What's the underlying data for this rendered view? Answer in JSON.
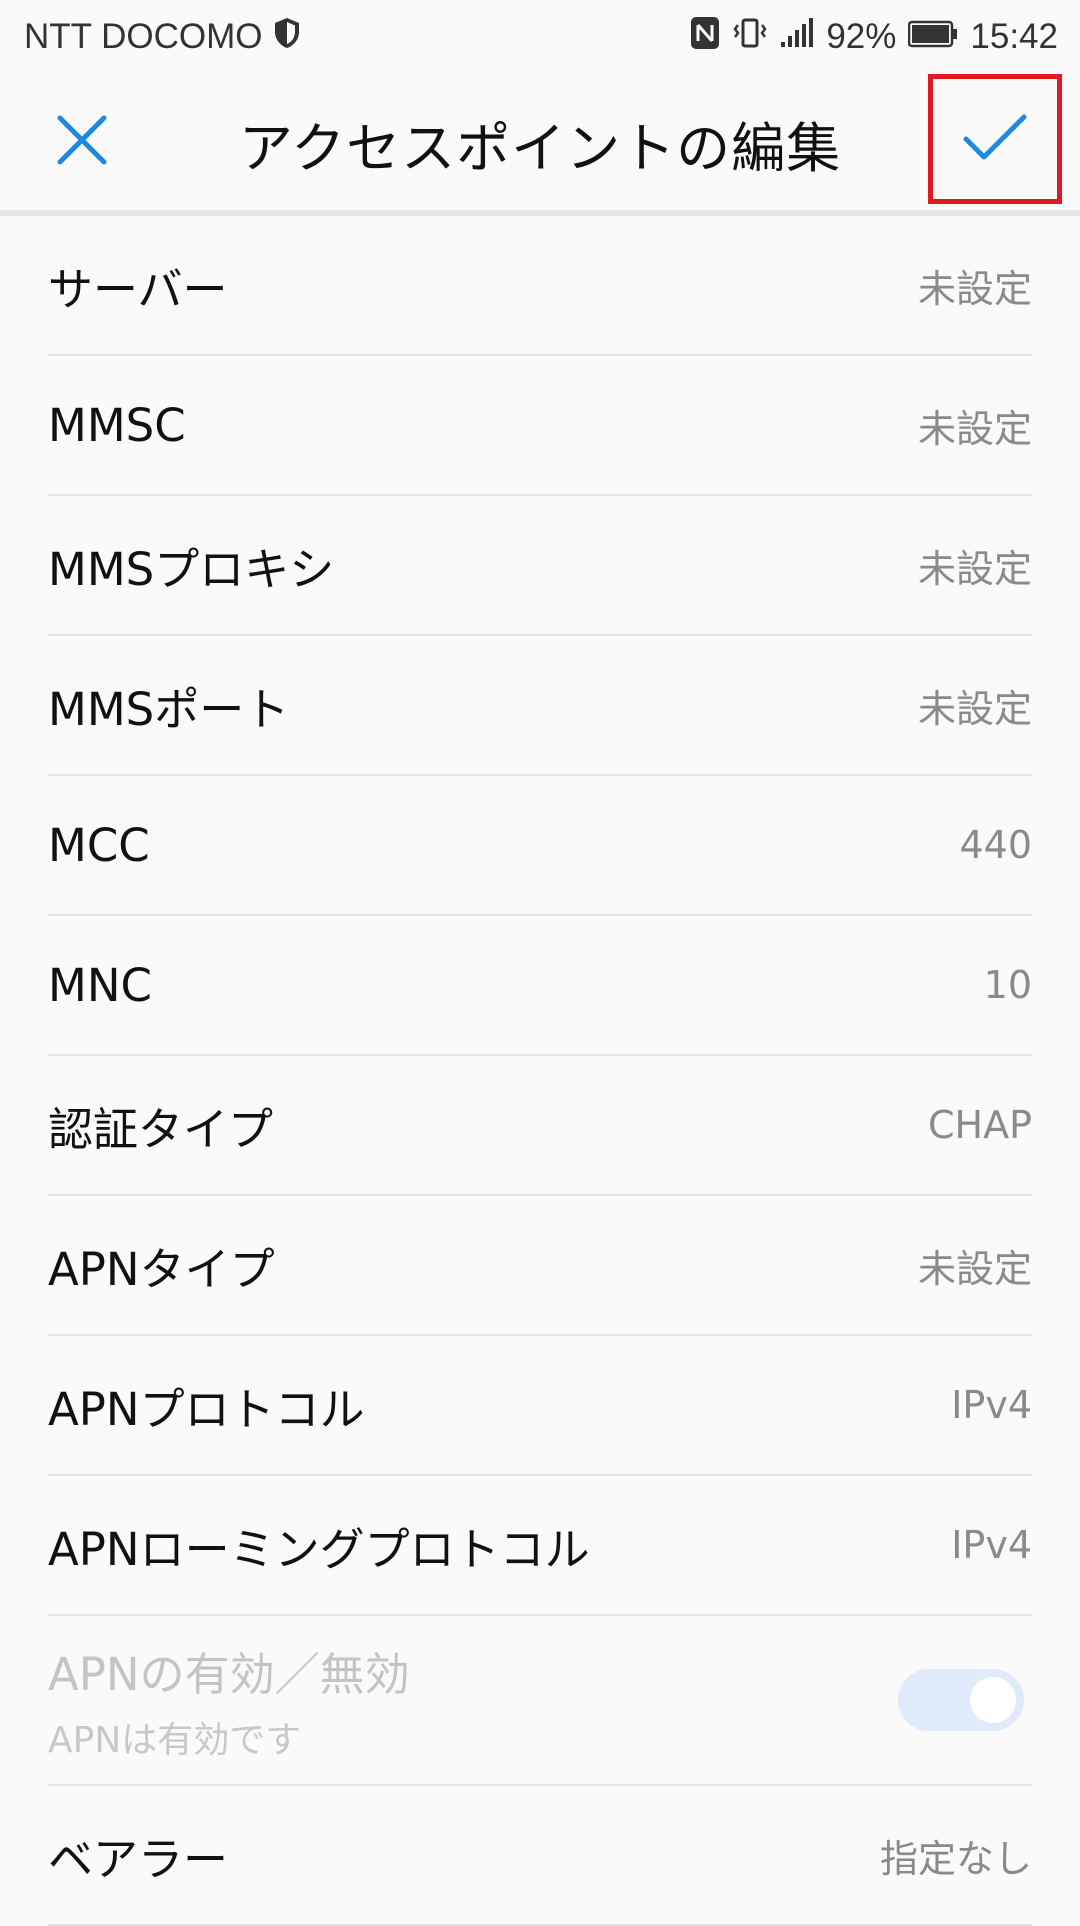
{
  "status_bar": {
    "carrier": "NTT DOCOMO",
    "battery": "92%",
    "time": "15:42"
  },
  "appbar": {
    "title": "アクセスポイントの編集",
    "accent_color": "#1e88e5",
    "highlight_color": "#e01a22"
  },
  "rows": [
    {
      "label": "サーバー",
      "value": "未設定"
    },
    {
      "label": "MMSC",
      "value": "未設定"
    },
    {
      "label": "MMSプロキシ",
      "value": "未設定"
    },
    {
      "label": "MMSポート",
      "value": "未設定"
    },
    {
      "label": "MCC",
      "value": "440"
    },
    {
      "label": "MNC",
      "value": "10"
    },
    {
      "label": "認証タイプ",
      "value": "CHAP"
    },
    {
      "label": "APNタイプ",
      "value": "未設定"
    },
    {
      "label": "APNプロトコル",
      "value": "IPv4"
    },
    {
      "label": "APNローミングプロトコル",
      "value": "IPv4"
    }
  ],
  "apn_toggle": {
    "label": "APNの有効／無効",
    "sublabel": "APNは有効です",
    "enabled": true
  },
  "bearer": {
    "label": "ベアラー",
    "value": "指定なし"
  }
}
